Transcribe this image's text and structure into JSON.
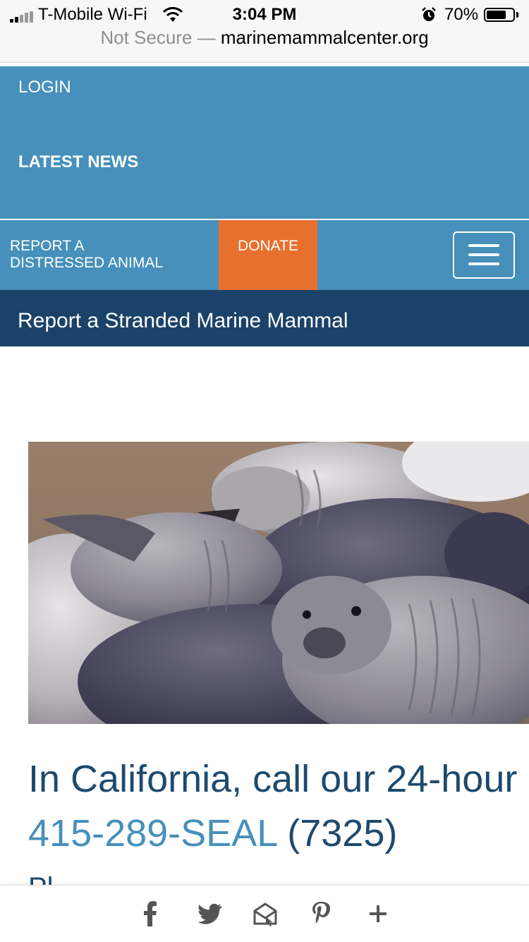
{
  "status_bar": {
    "carrier": "T-Mobile Wi-Fi",
    "time": "3:04 PM",
    "battery": "70%",
    "battery_level": 0.7,
    "icons": [
      "signal-icon",
      "wifi-icon",
      "alarm-icon",
      "battery-icon"
    ]
  },
  "url_bar": {
    "security": "Not Secure —",
    "domain": "marinemammalcenter.org"
  },
  "top_nav": {
    "login": "LOGIN",
    "latest_news": "LATEST NEWS"
  },
  "action_bar": {
    "report_line1": "REPORT A",
    "report_line2": "DISTRESSED ANIMAL",
    "donate": "DONATE",
    "menu_icon": "hamburger-icon"
  },
  "section_header": "Report a Stranded Marine Mammal",
  "main": {
    "call_text": "In California, call our 24-hour",
    "phone": "415-289-SEAL",
    "phone_number_suffix": " (7325)",
    "partial_line": "Pl"
  },
  "share_bar": {
    "icons": [
      "facebook-icon",
      "twitter-icon",
      "email-icon",
      "pinterest-icon",
      "more-icon"
    ]
  },
  "colors": {
    "nav_blue": "#4690bb",
    "donate_orange": "#e8702e",
    "dark_navy": "#1b4268",
    "heading_navy": "#1d4a6e"
  }
}
